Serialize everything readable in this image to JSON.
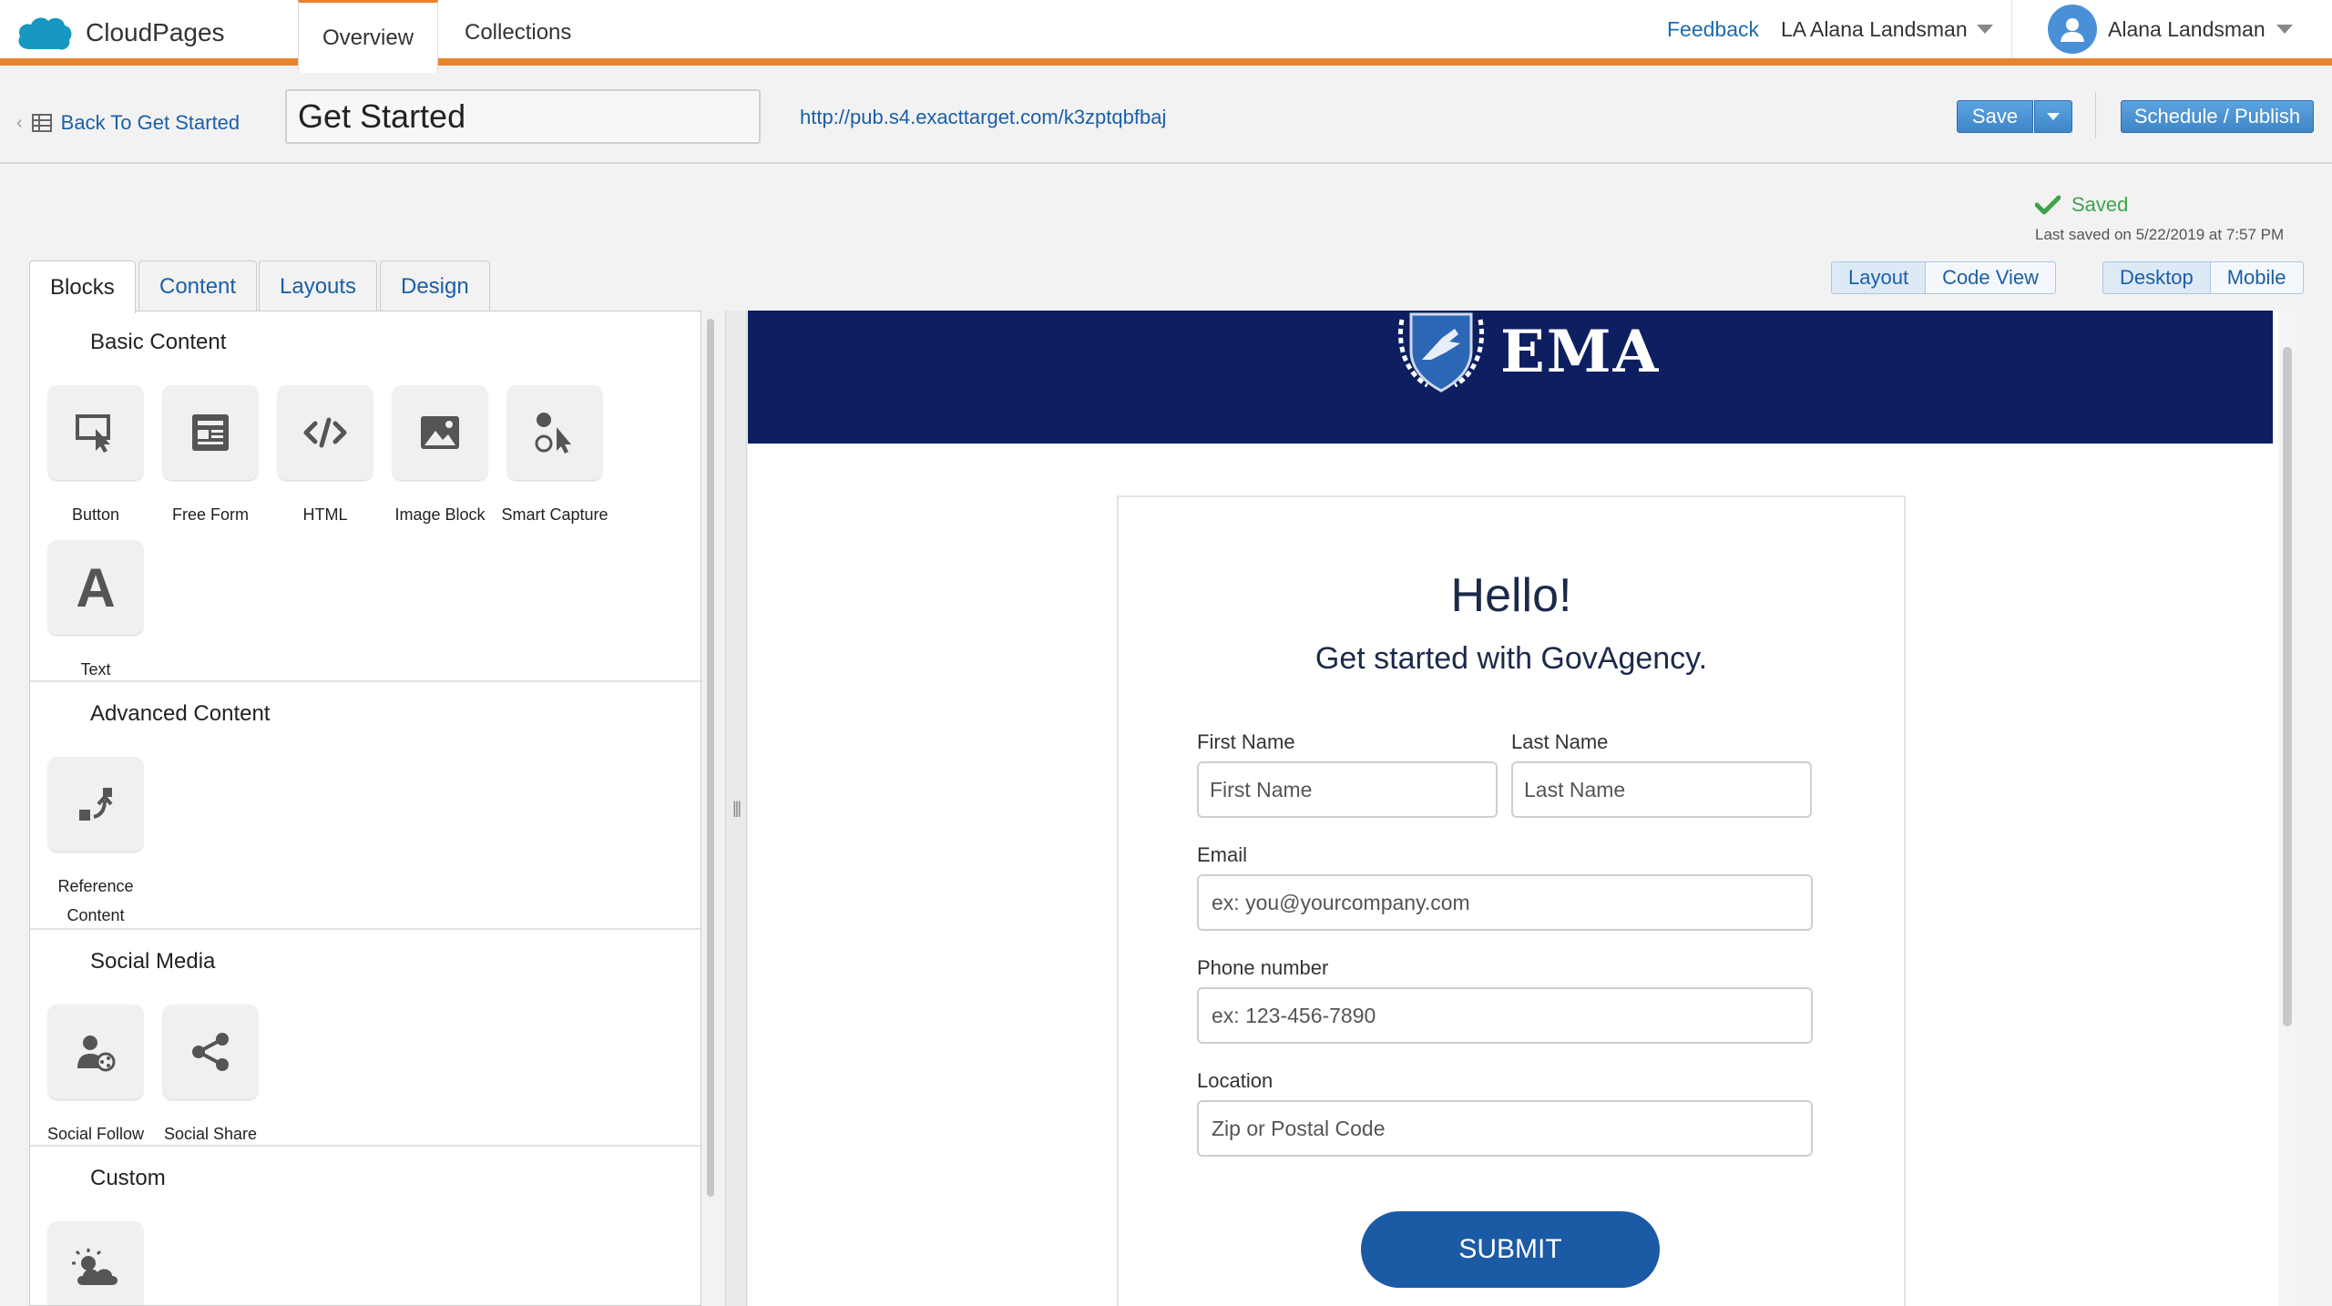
{
  "app": {
    "name": "CloudPages",
    "nav_tabs": [
      "Overview",
      "Collections"
    ],
    "feedback": "Feedback",
    "business_unit": "LA Alana Landsman",
    "user_name": "Alana Landsman"
  },
  "toolbar": {
    "back_label": "Back To Get Started",
    "page_title": "Get Started",
    "url": "http://pub.s4.exacttarget.com/k3zptqbfbaj",
    "save_label": "Save",
    "publish_label": "Schedule / Publish"
  },
  "status": {
    "saved_label": "Saved",
    "last_saved": "Last saved on 5/22/2019 at 7:57 PM"
  },
  "left_tabs": [
    "Blocks",
    "Content",
    "Layouts",
    "Design"
  ],
  "view_toggles": {
    "editor": [
      "Layout",
      "Code View"
    ],
    "device": [
      "Desktop",
      "Mobile"
    ]
  },
  "sections": {
    "basic": {
      "title": "Basic Content",
      "blocks": [
        "Button",
        "Free Form",
        "HTML",
        "Image Block",
        "Smart Capture",
        "Text"
      ]
    },
    "advanced": {
      "title": "Advanced Content",
      "blocks": [
        "Reference Content"
      ]
    },
    "social": {
      "title": "Social Media",
      "blocks": [
        "Social Follow",
        "Social Share"
      ]
    },
    "custom": {
      "title": "Custom"
    }
  },
  "canvas": {
    "logo_text": "EMA",
    "hello": "Hello!",
    "subtitle": "Get started with GovAgency.",
    "form": {
      "first_name_label": "First Name",
      "first_name_placeholder": "First Name",
      "last_name_label": "Last Name",
      "last_name_placeholder": "Last Name",
      "email_label": "Email",
      "email_placeholder": "ex: you@yourcompany.com",
      "phone_label": "Phone number",
      "phone_placeholder": "ex: 123-456-7890",
      "location_label": "Location",
      "location_placeholder": "Zip or Postal Code",
      "submit_label": "SUBMIT"
    }
  },
  "colors": {
    "accent_orange": "#e8832e",
    "link_blue": "#1a5fa8",
    "banner_navy": "#0e1f61",
    "submit_blue": "#1b5aa5",
    "saved_green": "#3fa24b"
  }
}
